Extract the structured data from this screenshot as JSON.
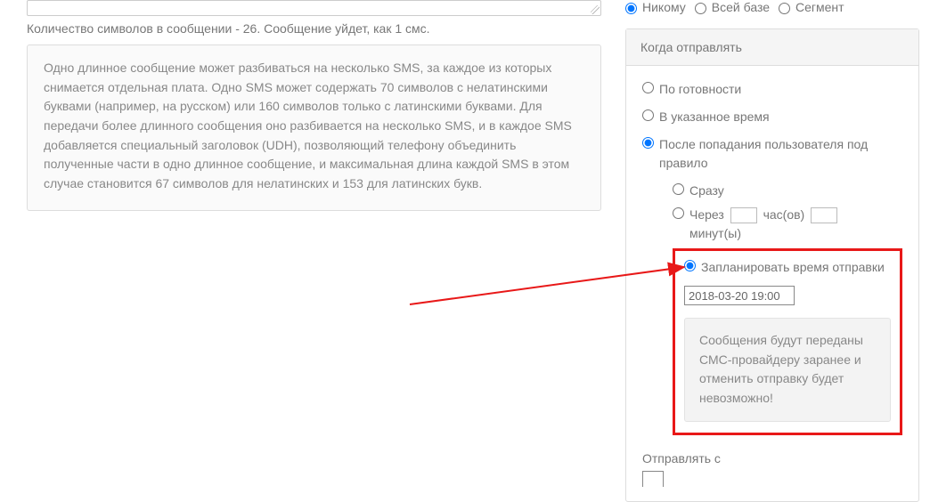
{
  "char_count_text": "Количество символов в сообщении - 26. Сообщение уйдет, как 1 смс.",
  "info_text": "Одно длинное сообщение может разбиваться на несколько SMS, за каждое из которых снимается отдельная плата. Одно SMS может содержать 70 символов с нелатинскими буквами (например, на русском) или 160 символов только с латинскими буквами. Для передачи более длинного сообщения оно разбивается на несколько SMS, и в каждое SMS добавляется специальный заголовок (UDH), позволяющий телефону объединить полученные части в одно длинное сообщение, и максимальная длина каждой SMS в этом случае становится 67 символов для нелатинских и 153 для латинских букв.",
  "audience": {
    "none": "Никому",
    "all": "Всей базе",
    "segment": "Сегмент"
  },
  "panel_title": "Когда отправлять",
  "when": {
    "ready": "По готовности",
    "at_time": "В указанное время",
    "after_rule": "После попадания пользователя под правило",
    "immediately": "Сразу",
    "after_delay_1": "Через",
    "after_delay_2": "час(ов)",
    "after_delay_3": "минут(ы)",
    "schedule": "Запланировать время отправки",
    "schedule_value": "2018-03-20 19:00",
    "warn": "Сообщения будут переданы СМС-провайдеру заранее и отменить отправку будет невозможно!"
  },
  "send_from_label": "Отправлять с"
}
